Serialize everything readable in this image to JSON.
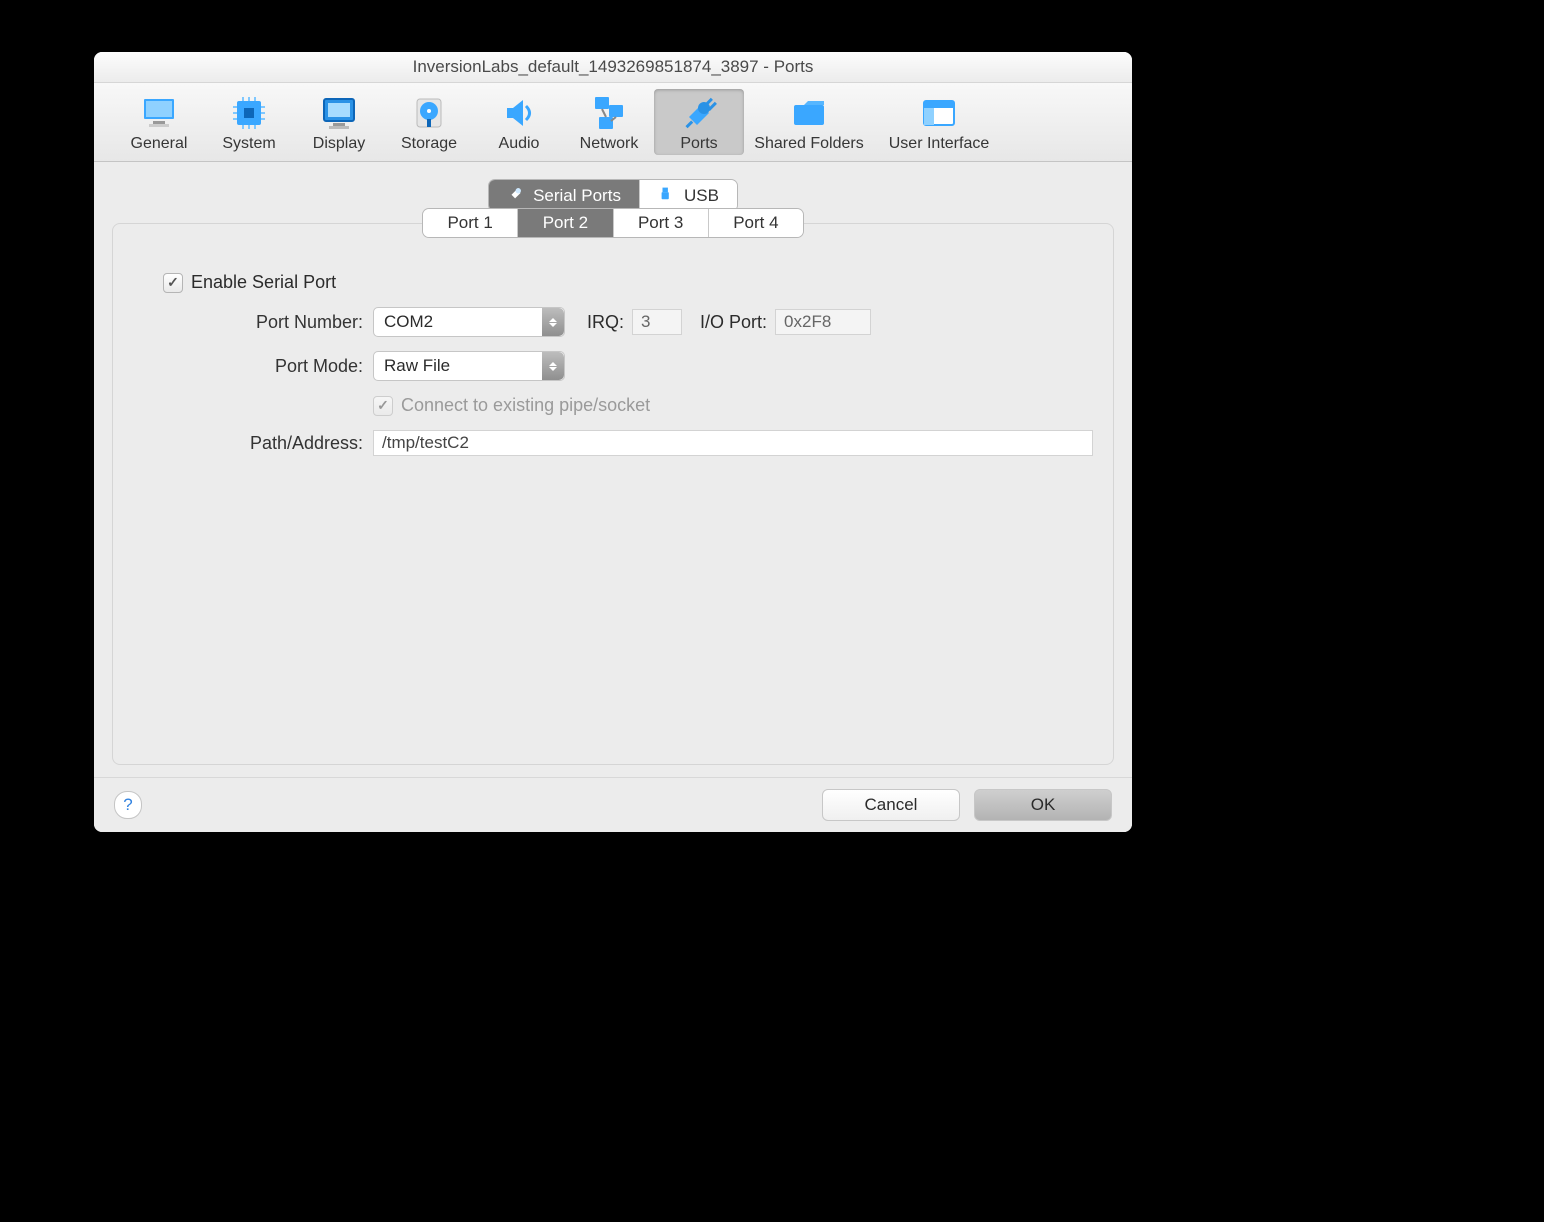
{
  "window": {
    "title": "InversionLabs_default_1493269851874_3897 - Ports"
  },
  "toolbar": [
    {
      "id": "general",
      "label": "General"
    },
    {
      "id": "system",
      "label": "System"
    },
    {
      "id": "display",
      "label": "Display"
    },
    {
      "id": "storage",
      "label": "Storage"
    },
    {
      "id": "audio",
      "label": "Audio"
    },
    {
      "id": "network",
      "label": "Network"
    },
    {
      "id": "ports",
      "label": "Ports",
      "selected": true
    },
    {
      "id": "shared",
      "label": "Shared Folders"
    },
    {
      "id": "ui",
      "label": "User Interface"
    }
  ],
  "subtabs": {
    "serial": "Serial Ports",
    "usb": "USB",
    "active": "serial"
  },
  "port_tabs": [
    "Port 1",
    "Port 2",
    "Port 3",
    "Port 4"
  ],
  "port_tab_active": 1,
  "form": {
    "enable_label": "Enable Serial Port",
    "enable_checked": true,
    "port_number_label": "Port Number:",
    "port_number_value": "COM2",
    "irq_label": "IRQ:",
    "irq_value": "3",
    "ioport_label": "I/O Port:",
    "ioport_value": "0x2F8",
    "port_mode_label": "Port Mode:",
    "port_mode_value": "Raw File",
    "connect_label": "Connect to existing pipe/socket",
    "connect_checked": true,
    "connect_disabled": true,
    "path_label": "Path/Address:",
    "path_value": "/tmp/testC2"
  },
  "footer": {
    "cancel": "Cancel",
    "ok": "OK"
  }
}
